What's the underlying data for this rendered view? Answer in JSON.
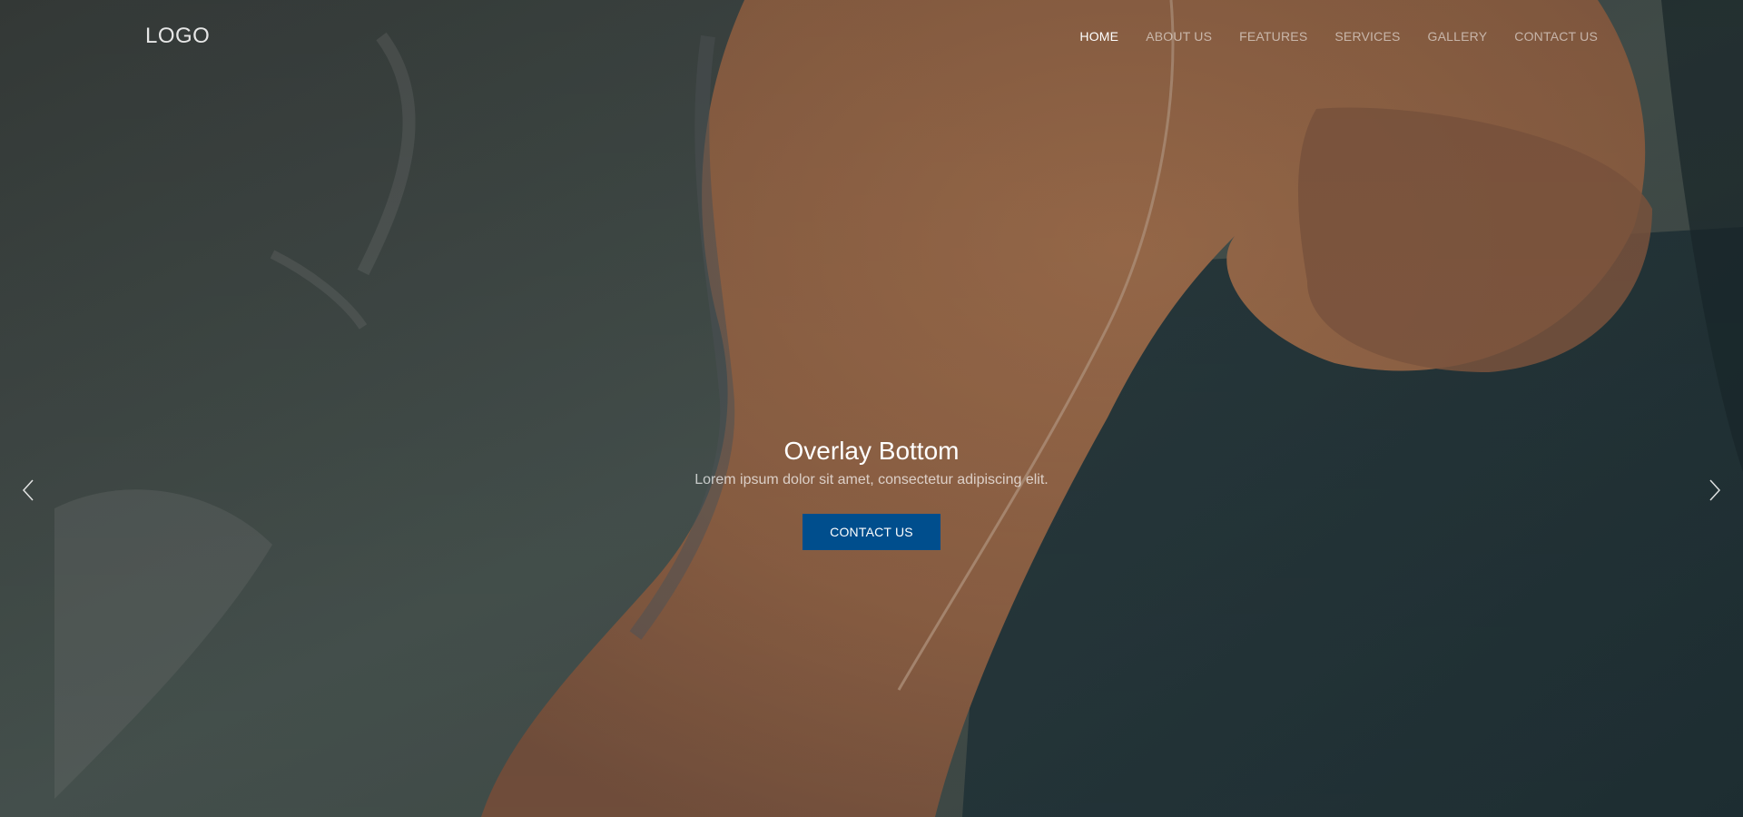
{
  "header": {
    "logo": "LOGO",
    "nav": [
      {
        "label": "HOME",
        "active": true
      },
      {
        "label": "ABOUT US",
        "active": false
      },
      {
        "label": "FEATURES",
        "active": false
      },
      {
        "label": "SERVICES",
        "active": false
      },
      {
        "label": "GALLERY",
        "active": false
      },
      {
        "label": "CONTACT US",
        "active": false
      }
    ]
  },
  "slide": {
    "title": "Overlay Bottom",
    "subtitle": "Lorem ipsum dolor sit amet, consectetur adipiscing elit.",
    "button_label": "CONTACT US"
  },
  "controls": {
    "prev_icon": "chevron-left-icon",
    "next_icon": "chevron-right-icon"
  },
  "colors": {
    "button_bg": "#004e8d",
    "water": "#3f4d4a",
    "sand": "#a0704f"
  }
}
